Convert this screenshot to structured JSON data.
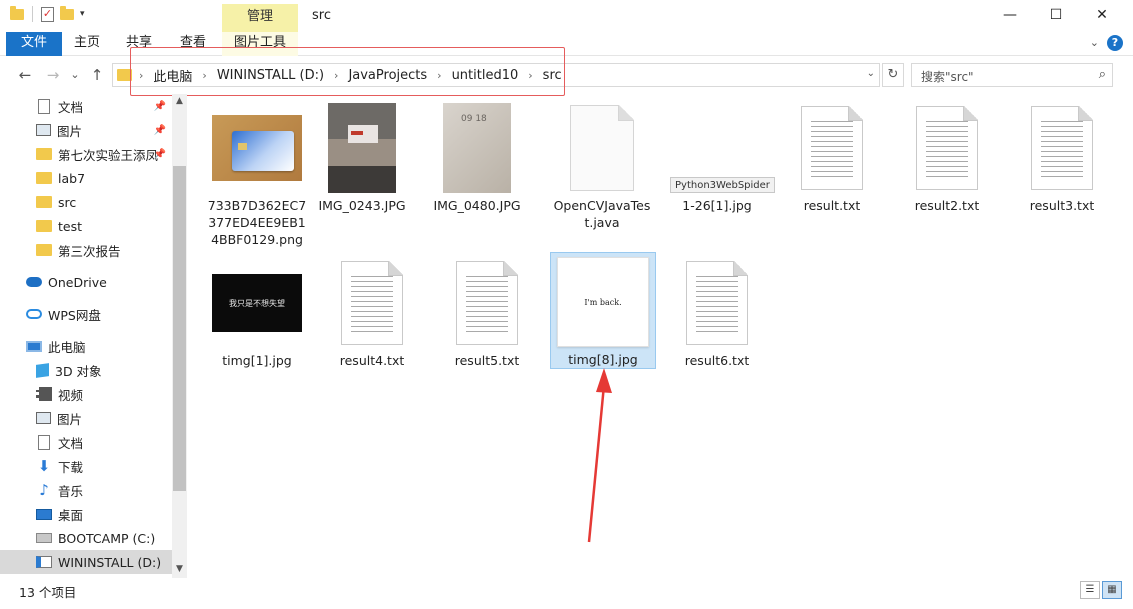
{
  "window": {
    "title": "src",
    "contextual_tab": "管理",
    "controls": {
      "minimize": "—",
      "maximize": "☐",
      "close": "✕"
    }
  },
  "ribbon": {
    "tabs": [
      "文件",
      "主页",
      "共享",
      "查看",
      "图片工具"
    ],
    "collapse_glyph": "⌄",
    "help_glyph": "?"
  },
  "nav": {
    "back": "←",
    "forward": "→",
    "recent": "⌄",
    "up": "↑",
    "breadcrumb": [
      "此电脑",
      "WININSTALL (D:)",
      "JavaProjects",
      "untitled10",
      "src"
    ],
    "chevron": "›",
    "dropdown": "⌄",
    "refresh": "↻",
    "search_placeholder": "搜索\"src\"",
    "search_icon": "⌕"
  },
  "sidebar": {
    "items": [
      {
        "label": "文档",
        "icon": "document-icon",
        "pinned": true
      },
      {
        "label": "图片",
        "icon": "pictures-icon",
        "pinned": true
      },
      {
        "label": "第七次实验王添凤",
        "icon": "folder-icon",
        "pinned": true
      },
      {
        "label": "lab7",
        "icon": "folder-icon",
        "pinned": false
      },
      {
        "label": "src",
        "icon": "folder-icon",
        "pinned": false
      },
      {
        "label": "test",
        "icon": "folder-icon",
        "pinned": false
      },
      {
        "label": "第三次报告",
        "icon": "folder-icon",
        "pinned": false
      },
      {
        "label": "OneDrive",
        "icon": "onedrive-icon",
        "pinned": false
      },
      {
        "label": "WPS网盘",
        "icon": "wps-cloud-icon",
        "pinned": false
      },
      {
        "label": "此电脑",
        "icon": "this-pc-icon",
        "pinned": false
      },
      {
        "label": "3D 对象",
        "icon": "3d-objects-icon",
        "pinned": false
      },
      {
        "label": "视频",
        "icon": "videos-icon",
        "pinned": false
      },
      {
        "label": "图片",
        "icon": "pictures-icon",
        "pinned": false
      },
      {
        "label": "文档",
        "icon": "document-icon",
        "pinned": false
      },
      {
        "label": "下载",
        "icon": "downloads-icon",
        "pinned": false
      },
      {
        "label": "音乐",
        "icon": "music-icon",
        "pinned": false
      },
      {
        "label": "桌面",
        "icon": "desktop-icon",
        "pinned": false
      },
      {
        "label": "BOOTCAMP (C:)",
        "icon": "drive-c-icon",
        "pinned": false
      },
      {
        "label": "WININSTALL (D:)",
        "icon": "drive-d-icon",
        "pinned": false,
        "selected": true
      }
    ],
    "pin_glyph": "📌",
    "scroll_up": "▲",
    "scroll_down": "▼"
  },
  "files": [
    {
      "name": "733B7D362EC7377ED4EE9EB14BBF0129.png",
      "kind": "image",
      "thumb": "bank-card"
    },
    {
      "name": "IMG_0243.JPG",
      "kind": "image",
      "thumb": "classroom"
    },
    {
      "name": "IMG_0480.JPG",
      "kind": "image",
      "thumb": "paper"
    },
    {
      "name": "OpenCVJavaTest.java",
      "kind": "java"
    },
    {
      "name": "1-26[1].jpg",
      "kind": "image",
      "thumb": "blank"
    },
    {
      "name": "result.txt",
      "kind": "txt"
    },
    {
      "name": "result2.txt",
      "kind": "txt"
    },
    {
      "name": "result3.txt",
      "kind": "txt"
    },
    {
      "name": "timg[1].jpg",
      "kind": "image",
      "thumb": "dark-text",
      "thumb_text": "我只是不想失望"
    },
    {
      "name": "result4.txt",
      "kind": "txt"
    },
    {
      "name": "result5.txt",
      "kind": "txt"
    },
    {
      "name": "timg[8].jpg",
      "kind": "image",
      "thumb": "white-text",
      "thumb_text": "I'm back.",
      "selected": true
    },
    {
      "name": "result6.txt",
      "kind": "txt"
    }
  ],
  "thumb_text": {
    "paper": "09 18"
  },
  "tooltip": "Python3WebSpider",
  "status": {
    "count": "13 个项目",
    "details_view": "☰",
    "thumbnail_view": "▦"
  },
  "annotation": {
    "box_color": "#e55c5c",
    "arrow_color": "#e53935"
  }
}
